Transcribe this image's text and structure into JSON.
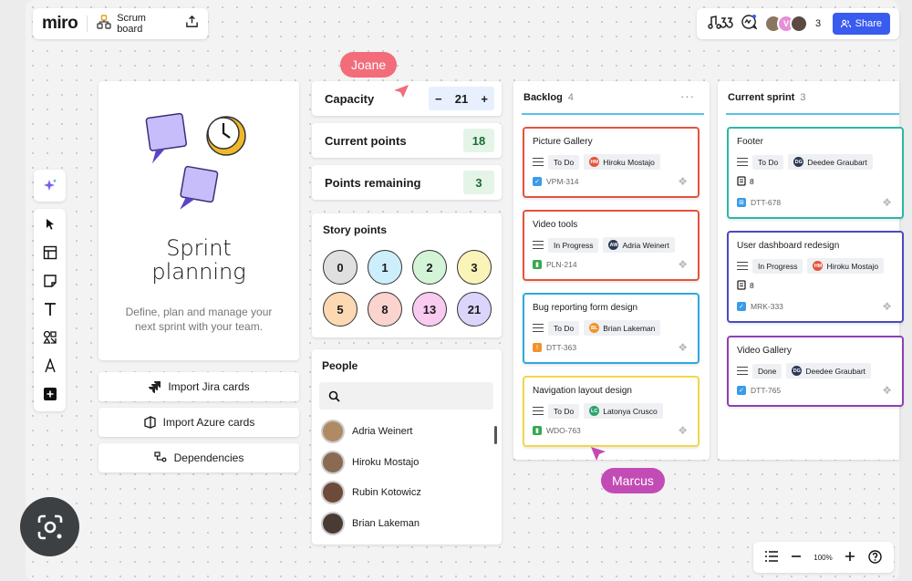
{
  "app": {
    "logo": "miro",
    "board_title": "Scrum board",
    "collaborator_count": "3",
    "share_label": "Share",
    "avatar_letter": "V"
  },
  "sprint_card": {
    "title": "Sprint planning",
    "description": "Define, plan and manage your next sprint with your team."
  },
  "imports": [
    {
      "label": "Import Jira cards"
    },
    {
      "label": "Import Azure cards"
    },
    {
      "label": "Dependencies"
    }
  ],
  "metrics": {
    "capacity": {
      "label": "Capacity",
      "value": "21",
      "minus": "−",
      "plus": "+"
    },
    "current_points": {
      "label": "Current points",
      "value": "18"
    },
    "points_remaining": {
      "label": "Points remaining",
      "value": "3"
    }
  },
  "story_points": {
    "title": "Story points",
    "values": [
      "0",
      "1",
      "2",
      "3",
      "5",
      "8",
      "13",
      "21"
    ],
    "colors": [
      "#e0e0e0",
      "#cdeffc",
      "#d3f4d6",
      "#fbf4b9",
      "#fcd9b2",
      "#fbd4cf",
      "#f9cbf0",
      "#dcd5fb"
    ]
  },
  "people": {
    "title": "People",
    "list": [
      {
        "name": "Adria Weinert",
        "color": "#b08a64"
      },
      {
        "name": "Hiroku Mostajo",
        "color": "#8a6a52"
      },
      {
        "name": "Rubin Kotowicz",
        "color": "#6e4a3a"
      },
      {
        "name": "Brian Lakeman",
        "color": "#4a3a34"
      }
    ]
  },
  "backlog": {
    "title": "Backlog",
    "count": "4",
    "more": "···",
    "cards": [
      {
        "title": "Picture Gallery",
        "status": "To Do",
        "assignee": "Hiroku Mostajo",
        "initials": "HM",
        "initials_color": "#e5533c",
        "code": "VPM-314",
        "border": "#e5533c",
        "tag_color": "#3a9be8",
        "tag_glyph": "✓"
      },
      {
        "title": "Video tools",
        "status": "In Progress",
        "assignee": "Adria Weinert",
        "initials": "AW",
        "initials_color": "#2d3a55",
        "code": "PLN-214",
        "border": "#e5533c",
        "tag_color": "#36a852",
        "tag_glyph": "▮"
      },
      {
        "title": "Bug reporting form design",
        "status": "To Do",
        "assignee": "Brian Lakeman",
        "initials": "BL",
        "initials_color": "#f0932b",
        "code": "DTT-363",
        "border": "#2ea7e0",
        "tag_color": "#f0932b",
        "tag_glyph": "!"
      },
      {
        "title": "Navigation layout design",
        "status": "To Do",
        "assignee": "Latonya Crusco",
        "initials": "LC",
        "initials_color": "#2aa36b",
        "code": "WDO-763",
        "border": "#f2d64b",
        "tag_color": "#36a852",
        "tag_glyph": "▮"
      }
    ]
  },
  "current_sprint": {
    "title": "Current sprint",
    "count": "3",
    "cards": [
      {
        "title": "Footer",
        "status": "To Do",
        "assignee": "Deedee Graubart",
        "initials": "DG",
        "initials_color": "#2d3a55",
        "estimate": "8",
        "code": "DTT-678",
        "border": "#2bb8a6",
        "tag_color": "#3a9be8",
        "tag_glyph": "⊞"
      },
      {
        "title": "User dashboard redesign",
        "status": "In Progress",
        "assignee": "Hiroku Mostajo",
        "initials": "HM",
        "initials_color": "#e5533c",
        "estimate": "8",
        "code": "MRK-333",
        "border": "#4a4bbd",
        "tag_color": "#3a9be8",
        "tag_glyph": "✓"
      },
      {
        "title": "Video Gallery",
        "status": "Done",
        "assignee": "Deedee Graubart",
        "initials": "DG",
        "initials_color": "#2d3a55",
        "code": "DTT-765",
        "border": "#8e3fb5",
        "tag_color": "#3a9be8",
        "tag_glyph": "✓"
      }
    ]
  },
  "cursors": [
    {
      "name": "Joane",
      "color": "#f26c7a"
    },
    {
      "name": "Marcus",
      "color": "#c34bb5"
    }
  ],
  "zoom": {
    "level": "100%"
  }
}
